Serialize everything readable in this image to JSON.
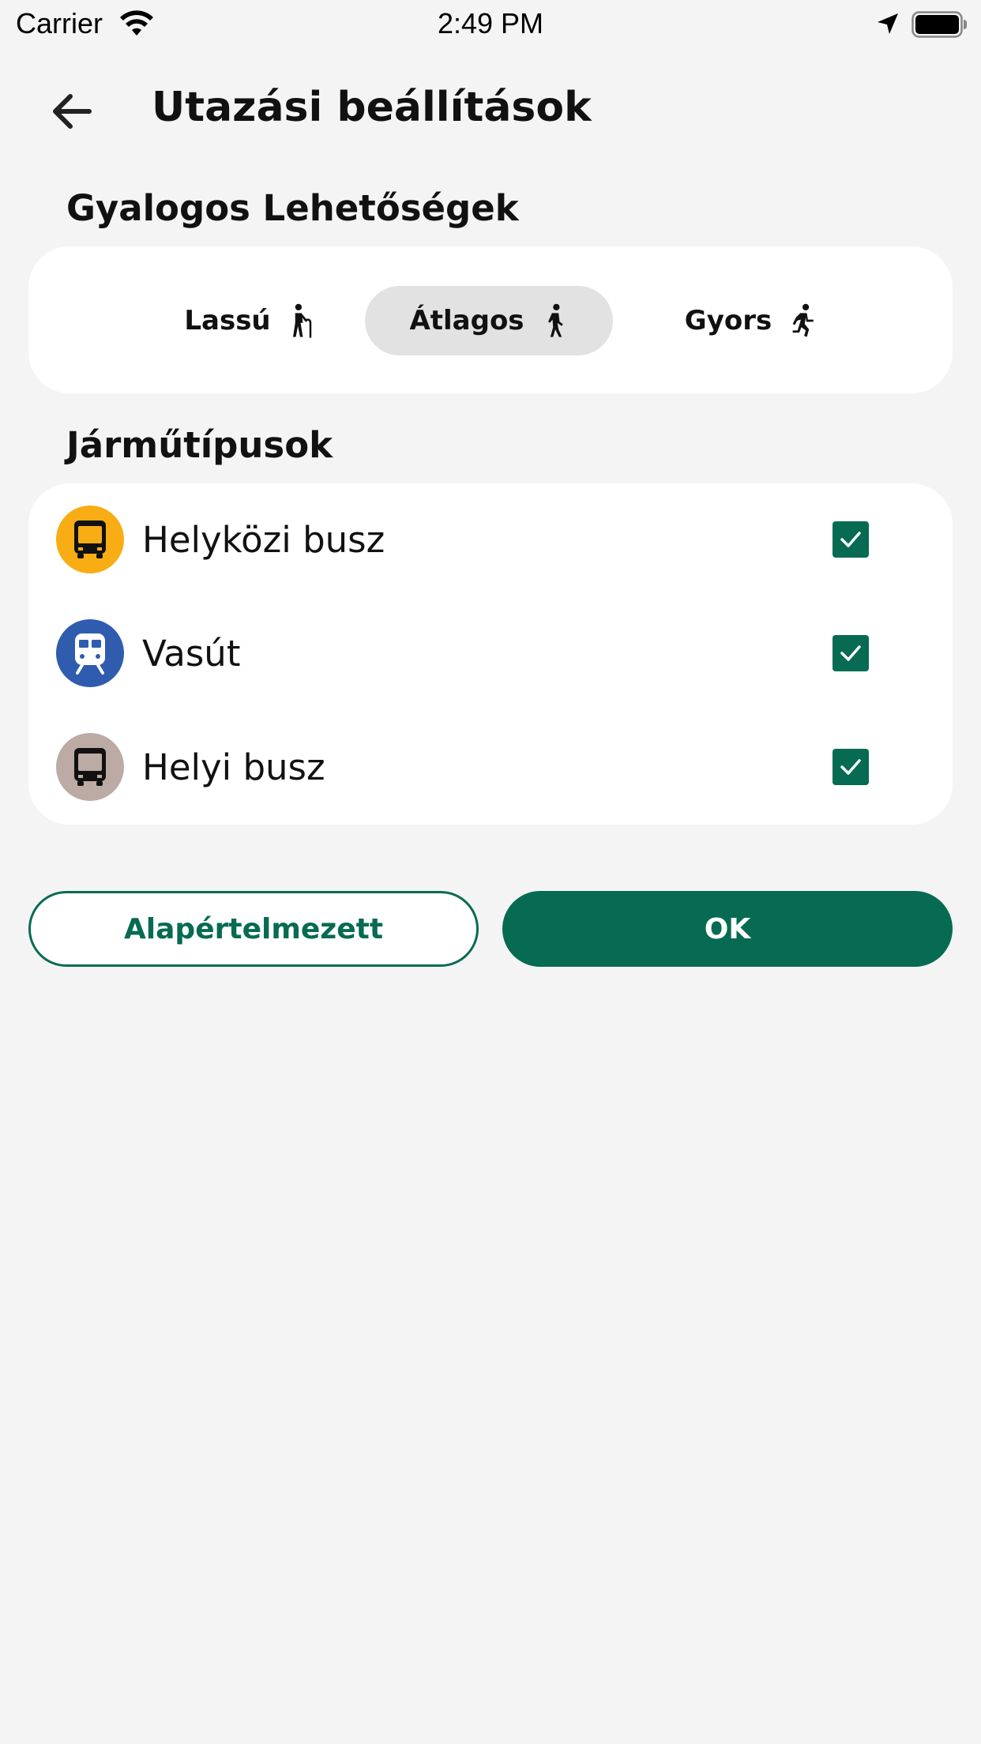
{
  "status_bar": {
    "carrier": "Carrier",
    "time": "2:49 PM"
  },
  "header": {
    "title": "Utazási beállítások"
  },
  "walking": {
    "section_title": "Gyalogos Lehetőségek",
    "options": [
      {
        "label": "Lassú",
        "icon": "elderly-walk-icon",
        "selected": false
      },
      {
        "label": "Átlagos",
        "icon": "walk-icon",
        "selected": true
      },
      {
        "label": "Gyors",
        "icon": "run-icon",
        "selected": false
      }
    ]
  },
  "vehicles": {
    "section_title": "Járműtípusok",
    "items": [
      {
        "label": "Helyközi busz",
        "icon": "intercity-bus-icon",
        "icon_bg": "#f8ad14",
        "checked": true
      },
      {
        "label": "Vasút",
        "icon": "train-icon",
        "icon_bg": "#2f5cae",
        "checked": true
      },
      {
        "label": "Helyi busz",
        "icon": "local-bus-icon",
        "icon_bg": "#bcaaa4",
        "checked": true
      }
    ]
  },
  "buttons": {
    "default_label": "Alapértelmezett",
    "ok_label": "OK"
  },
  "colors": {
    "accent": "#066b52",
    "background": "#f4f4f4",
    "card": "#ffffff",
    "selected_segment": "#e2e2e2"
  }
}
